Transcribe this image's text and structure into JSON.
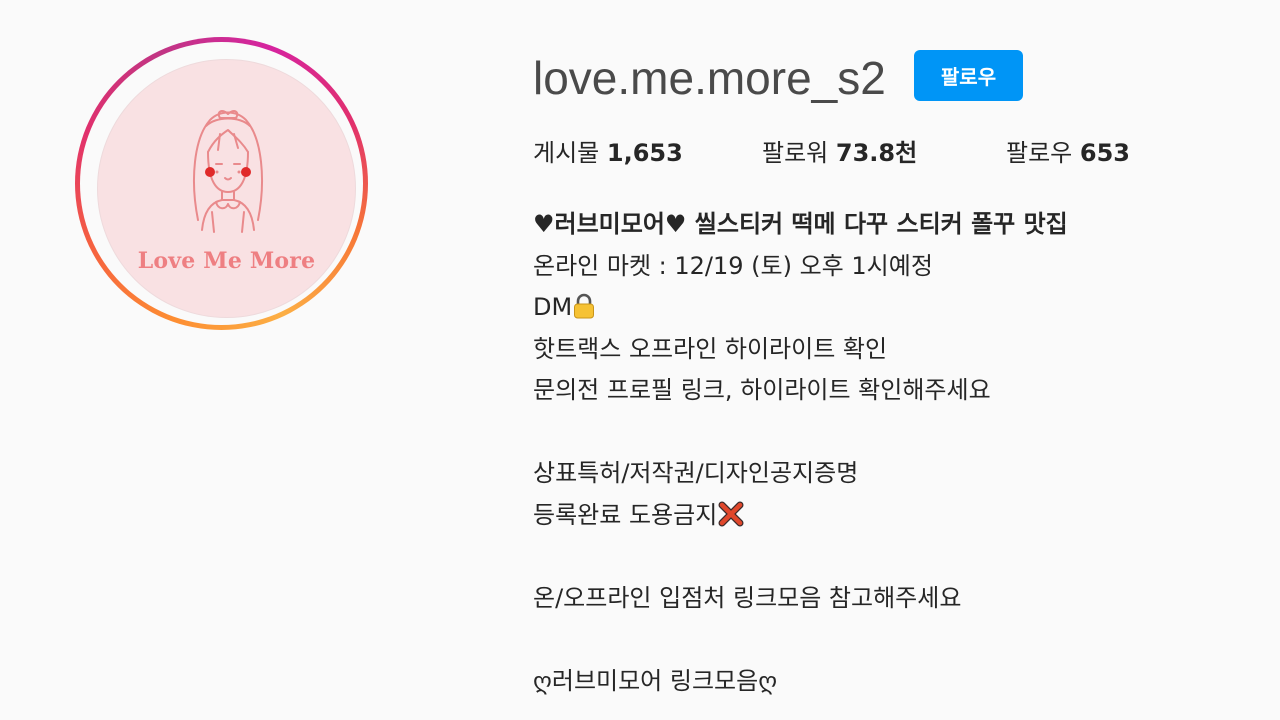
{
  "profile": {
    "username": "love.me.more_s2",
    "follow_label": "팔로우",
    "avatar_brand_text": "Love Me More"
  },
  "stats": {
    "posts_label": "게시물",
    "posts_value": "1,653",
    "followers_label": "팔로워",
    "followers_value": "73.8천",
    "following_label": "팔로우",
    "following_value": "653"
  },
  "bio": {
    "name": "♥러브미모어♥ 씰스티커 떡메 다꾸 스티커 폴꾸 맛집",
    "line1": "온라인 마켓 : 12/19 (토) 오후 1시예정",
    "line2": "DM",
    "line3": "핫트랙스 오프라인 하이라이트 확인",
    "line4": "문의전 프로필 링크, 하이라이트 확인해주세요",
    "line5": "상표특허/저작권/디자인공지증명",
    "line6": "등록완료 도용금지",
    "line7": "온/오프라인 입점처 링크모음 참고해주세요",
    "line8": "ღ러브미모어 링크모음ღ"
  },
  "icons": {
    "dm_icon": "lock-icon",
    "warning_icon": "cross-mark-icon"
  },
  "colors": {
    "accent": "#0095f6",
    "avatar_bg": "#f9e1e3",
    "brand_pink": "#ee7f82"
  }
}
